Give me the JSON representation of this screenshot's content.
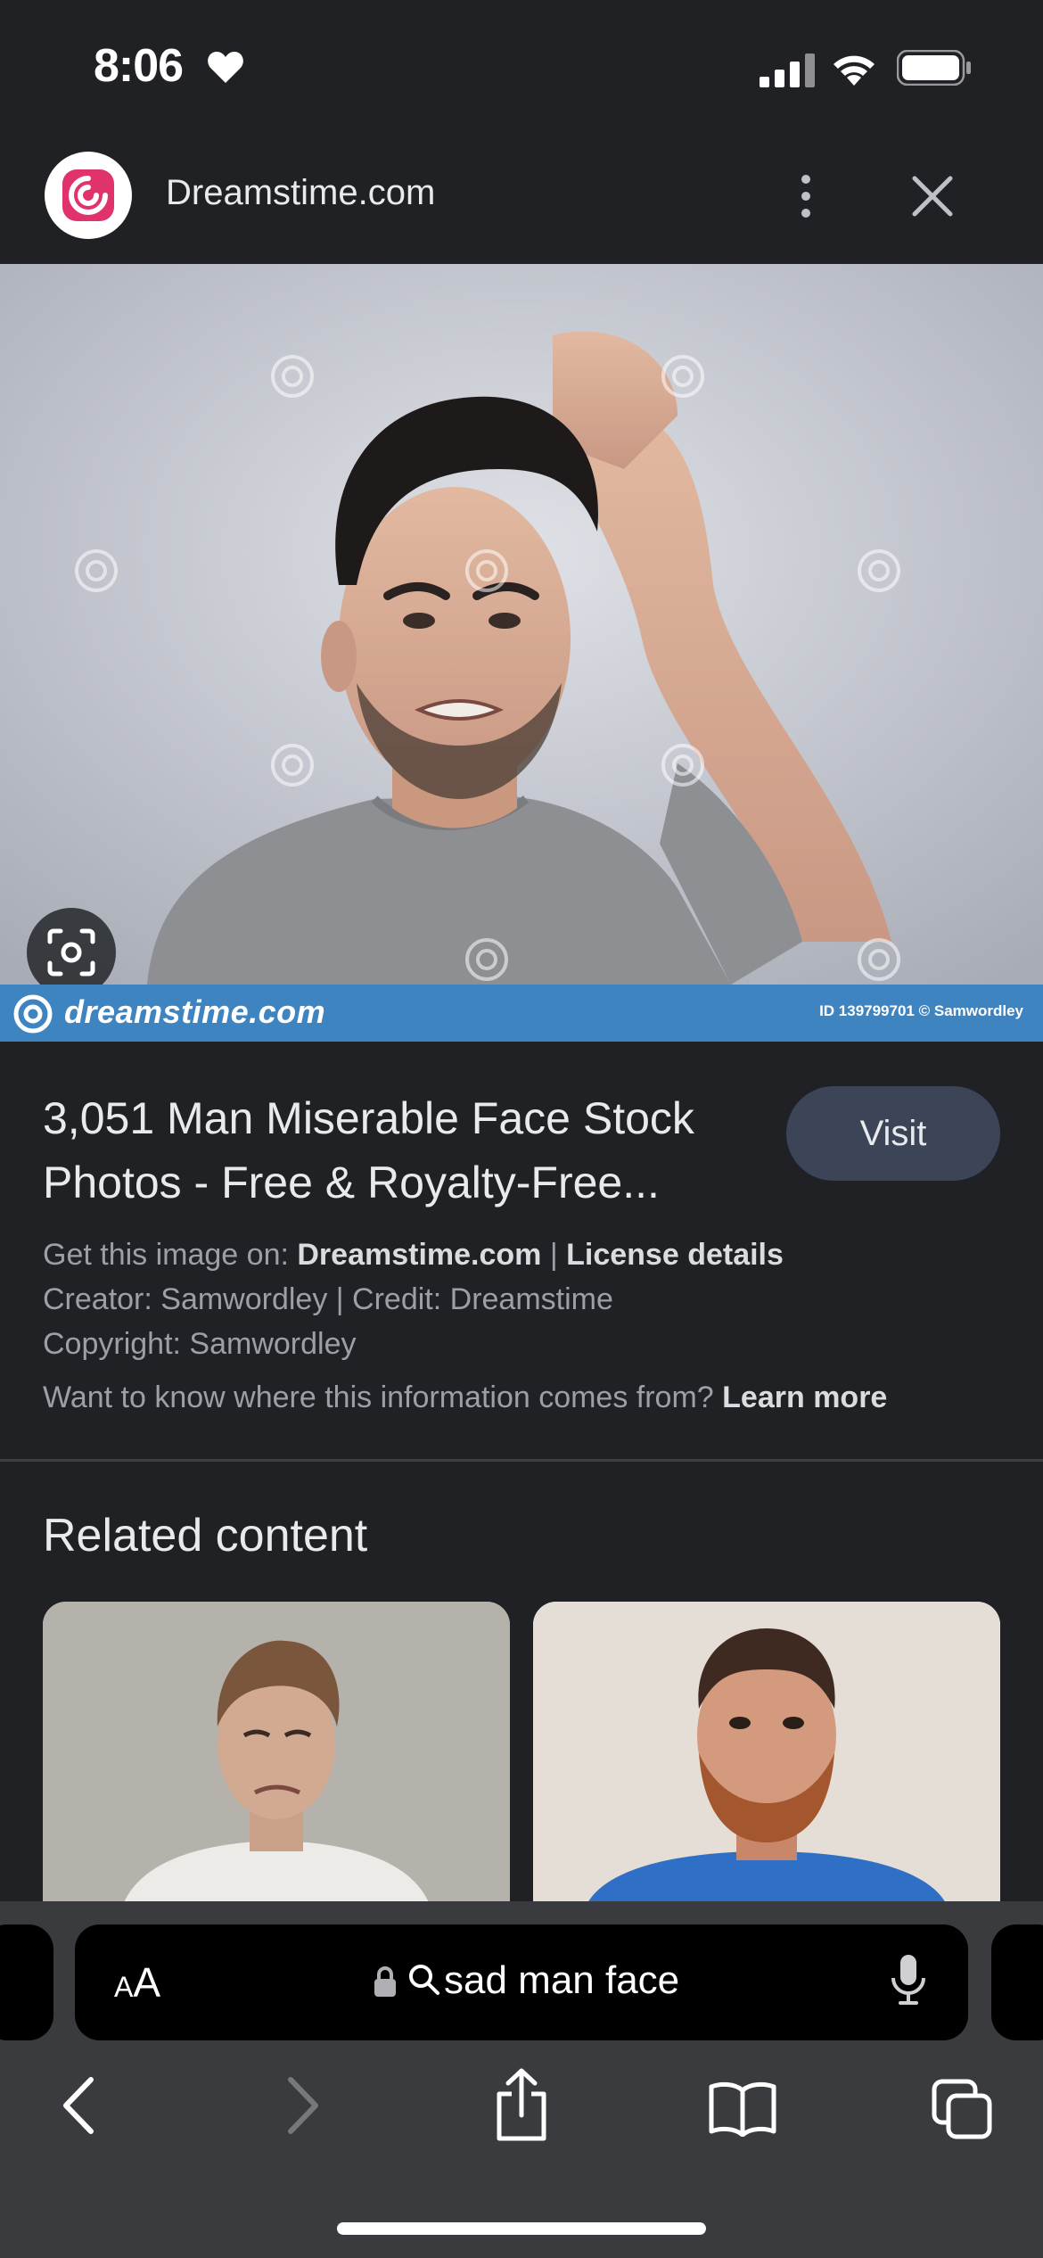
{
  "status_bar": {
    "time": "8:06"
  },
  "header": {
    "site_name": "Dreamstime.com"
  },
  "hero": {
    "brand_text": "dreamstime.com",
    "image_id_text": "ID 139799701 © Samwordley"
  },
  "result": {
    "title_line1": "3,051 Man Miserable Face Stock",
    "title_line2": "Photos - Free & Royalty-Free...",
    "visit_label": "Visit",
    "get_image_prefix": "Get this image on: ",
    "get_image_source": "Dreamstime.com",
    "separator": " | ",
    "license_label": "License details",
    "creator_line": "Creator: Samwordley | Credit: Dreamstime",
    "copyright_line": "Copyright: Samwordley",
    "info_question": "Want to know where this information comes from? ",
    "learn_more": "Learn more"
  },
  "related": {
    "title": "Related content"
  },
  "address_bar": {
    "aa_small": "A",
    "aa_large": "A",
    "query": "sad man face"
  },
  "colors": {
    "background": "#202124",
    "visit_button": "#3c4458",
    "watermark_bar": "#3e84c1",
    "toolbar": "#3a3b3e",
    "brand_pink": "#e0336b"
  }
}
